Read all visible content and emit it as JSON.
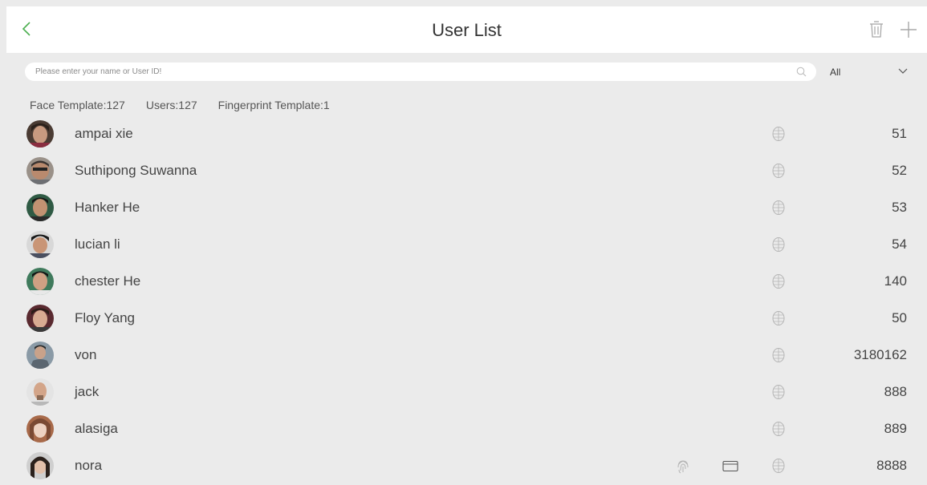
{
  "header": {
    "title": "User List"
  },
  "search": {
    "placeholder": "Please enter your name or User ID!",
    "value": ""
  },
  "filter": {
    "selected": "All"
  },
  "stats": {
    "face": "Face Template:127",
    "users": "Users:127",
    "fingerprint": "Fingerprint Template:1"
  },
  "colors": {
    "accent": "#4caf50",
    "background": "#ebebeb",
    "header_bg": "#ffffff",
    "text": "#444444",
    "icon_gray": "#b5b5b5"
  },
  "users": [
    {
      "name": "ampai xie",
      "id": "51",
      "fingerprint": false,
      "card": false,
      "face": true
    },
    {
      "name": "Suthipong Suwanna",
      "id": "52",
      "fingerprint": false,
      "card": false,
      "face": true
    },
    {
      "name": "Hanker He",
      "id": "53",
      "fingerprint": false,
      "card": false,
      "face": true
    },
    {
      "name": "lucian li",
      "id": "54",
      "fingerprint": false,
      "card": false,
      "face": true
    },
    {
      "name": "chester He",
      "id": "140",
      "fingerprint": false,
      "card": false,
      "face": true
    },
    {
      "name": "Floy Yang",
      "id": "50",
      "fingerprint": false,
      "card": false,
      "face": true
    },
    {
      "name": "von",
      "id": "3180162",
      "fingerprint": false,
      "card": false,
      "face": true
    },
    {
      "name": "jack",
      "id": "888",
      "fingerprint": false,
      "card": false,
      "face": true
    },
    {
      "name": "alasiga",
      "id": "889",
      "fingerprint": false,
      "card": false,
      "face": true
    },
    {
      "name": "nora",
      "id": "8888",
      "fingerprint": true,
      "card": true,
      "face": true
    }
  ]
}
